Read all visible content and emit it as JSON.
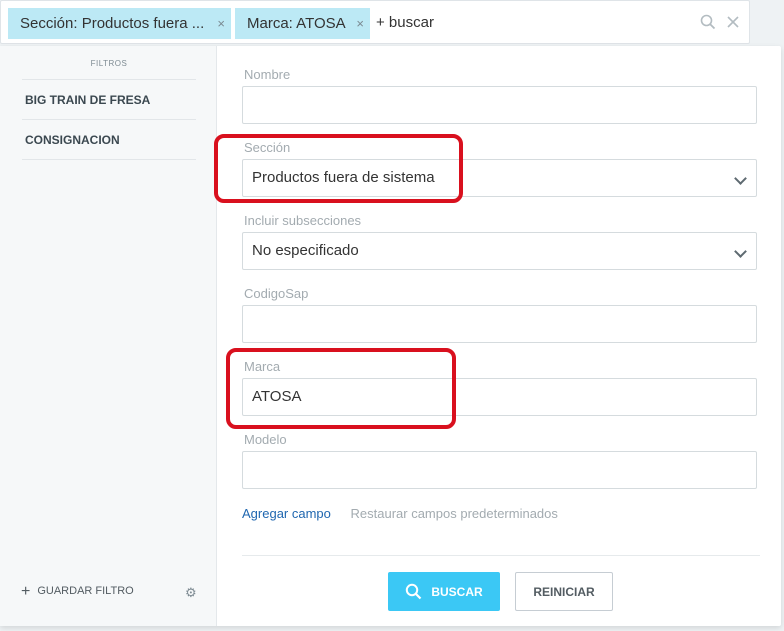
{
  "search_bar": {
    "chips": [
      {
        "label": "Sección: Productos fuera ...",
        "close": "×"
      },
      {
        "label": "Marca: ATOSA",
        "close": "×"
      }
    ],
    "add_search_label": "+ buscar",
    "clear_glyph": "✕"
  },
  "left_panel": {
    "title": "FILTROS",
    "items": [
      {
        "label": "BIG TRAIN DE FRESA"
      },
      {
        "label": "CONSIGNACION"
      }
    ],
    "save_filter_label": "GUARDAR FILTRO",
    "save_filter_plus": "+",
    "gear_glyph": "⚙"
  },
  "form": {
    "fields": [
      {
        "label": "Nombre",
        "value": ""
      },
      {
        "label": "Sección",
        "value": "Productos fuera de sistema"
      },
      {
        "label": "Incluir subsecciones",
        "value": "No especificado"
      },
      {
        "label": "CodigoSap",
        "value": ""
      },
      {
        "label": "Marca",
        "value": "ATOSA"
      },
      {
        "label": "Modelo",
        "value": ""
      }
    ],
    "add_field_link": "Agregar campo",
    "restore_link": "Restaurar campos predeterminados",
    "search_button": "BUSCAR",
    "reset_button": "REINICIAR"
  },
  "edge_marks": [
    "E",
    "R",
    "E",
    "0"
  ],
  "colors": {
    "chip_bg": "#bce9f5",
    "accent": "#3bc8f5",
    "link": "#2067b0",
    "annotation": "#d9101e"
  }
}
